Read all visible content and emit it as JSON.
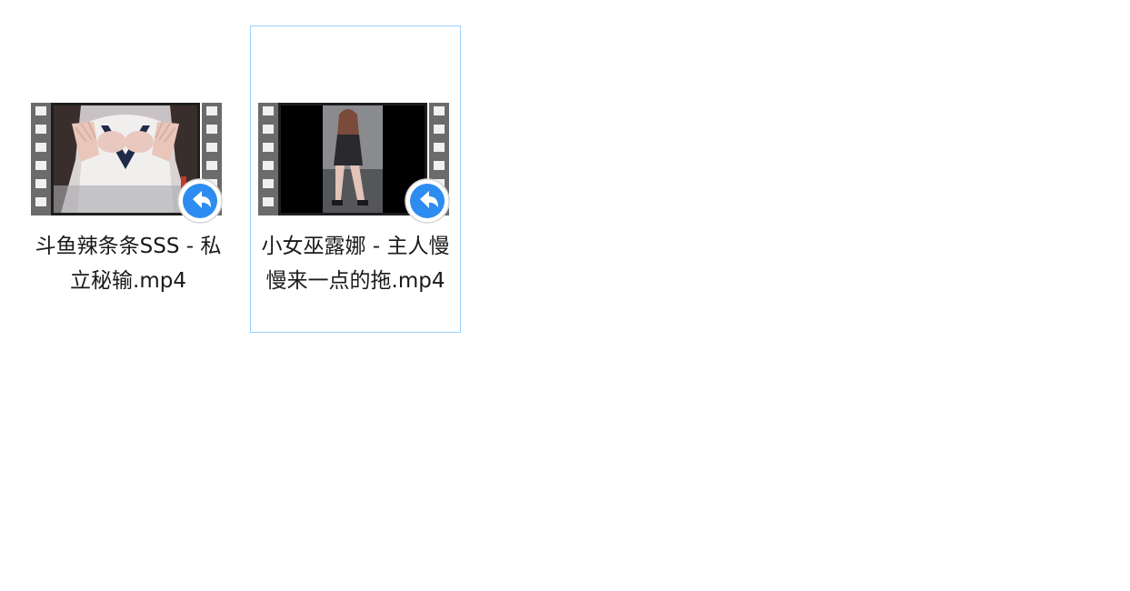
{
  "files": [
    {
      "name": "斗鱼辣条条SSS - 私立秘输.mp4",
      "selected": false,
      "icon": "video-thumbnail-icon",
      "overlay_icon": "shortcut-arrow-icon"
    },
    {
      "name": "小女巫露娜 - 主人慢慢来一点的拖.mp4",
      "selected": true,
      "icon": "video-thumbnail-icon",
      "overlay_icon": "shortcut-arrow-icon"
    }
  ],
  "colors": {
    "selection_border": "#99d1ff",
    "filmstrip": "#6b6b6b",
    "shortcut_blue": "#2d8cf0"
  }
}
